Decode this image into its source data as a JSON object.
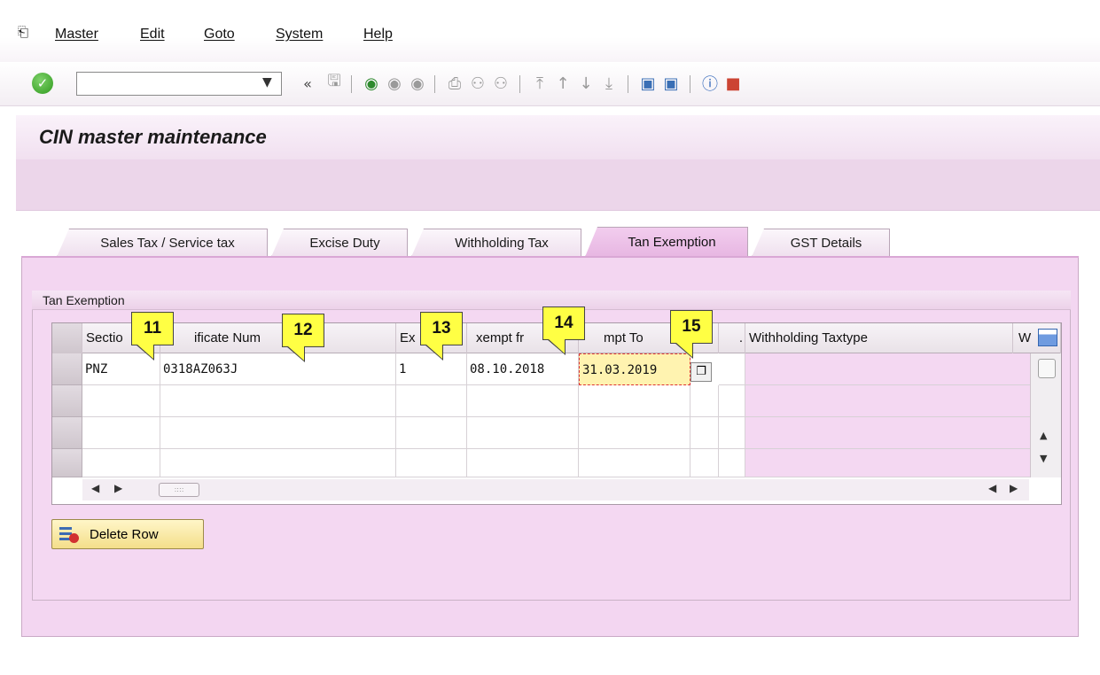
{
  "menu": [
    "Master",
    "Edit",
    "Goto",
    "System",
    "Help"
  ],
  "toolbar": {
    "command_value": ""
  },
  "title": "CIN master maintenance",
  "tabs": [
    {
      "label": "Sales Tax / Service tax",
      "active": false
    },
    {
      "label": "Excise Duty",
      "active": false
    },
    {
      "label": "Withholding Tax",
      "active": false
    },
    {
      "label": "Tan Exemption",
      "active": true
    },
    {
      "label": "GST Details",
      "active": false
    }
  ],
  "group_title": "Tan Exemption",
  "table": {
    "columns": [
      "Sectio",
      "ificate Num",
      "Ex",
      "xempt fr",
      "mpt To",
      ".",
      "Withholding Taxtype",
      "W"
    ],
    "rows": [
      {
        "section": "PNZ",
        "certificate": "0318AZ063J",
        "ex": "1",
        "from": "08.10.2018",
        "to": "31.03.2019"
      }
    ]
  },
  "delete_row_label": "Delete Row",
  "callouts": [
    "11",
    "12",
    "13",
    "14",
    "15"
  ],
  "colors": {
    "tab_active": "#e7b6e2",
    "page_bg": "#f3d6f1",
    "focus_cell": "#fff3b0",
    "callout": "#ffff44"
  }
}
